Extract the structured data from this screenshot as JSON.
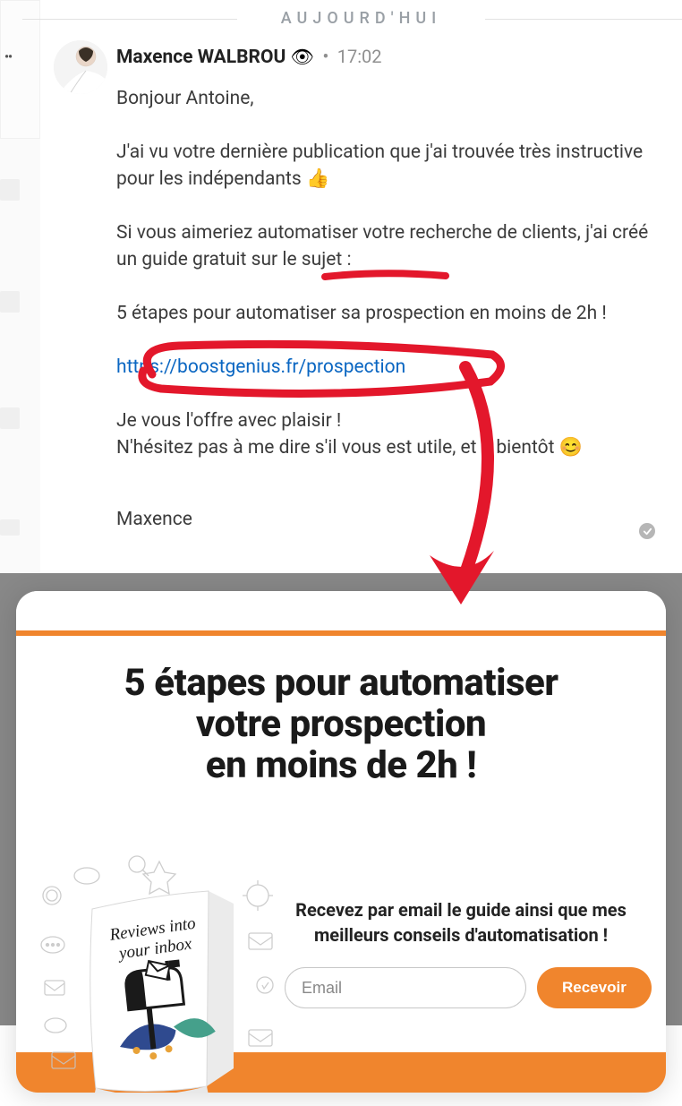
{
  "date_divider": "AUJOURD'HUI",
  "message": {
    "sender_name": "Maxence WALBROU",
    "eye_emoji": "👁",
    "time": "17:02",
    "greeting": "Bonjour Antoine,",
    "para1_text": "J'ai vu votre dernière publication que j'ai trouvée très instructive pour les indépendants ",
    "para1_emoji": "👍",
    "para2": "Si vous aimeriez automatiser votre recherche de clients, j'ai créé un guide gratuit sur le sujet :",
    "para3": "5 étapes pour automatiser sa prospection en moins de 2h !",
    "link": "https://boostgenius.fr/prospection",
    "para4_line1": "Je vous l'offre avec plaisir !",
    "para4_line2a": "N'hésitez pas à me dire s'il vous est utile, et à bientôt ",
    "para4_emoji": "😊",
    "signoff": "Maxence"
  },
  "landing": {
    "title_line1": "5 étapes pour automatiser",
    "title_line2": "votre prospection",
    "title_line3": "en moins de 2h !",
    "book_title_line1": "Reviews into",
    "book_title_line2": "your inbox",
    "subtext_line1": "Recevez par email le guide ainsi que mes",
    "subtext_line2": "meilleurs conseils d'automatisation !",
    "email_placeholder": "Email",
    "submit_label": "Recevoir"
  }
}
